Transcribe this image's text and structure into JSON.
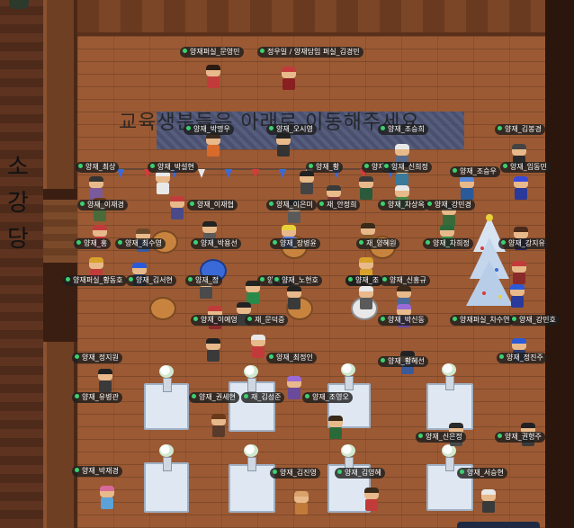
{
  "room": {
    "stage_label": "소강당",
    "notice": "교육생분들은 아래로 이동해주세요"
  },
  "colors": {
    "floor": "#9b5a34",
    "wall": "#5e3420",
    "banner": "#4a5e8a",
    "nametag_bg": "#1e1e1e",
    "online_dot": "#3bd16f"
  },
  "icons": {
    "online_status": "online-dot-icon",
    "christmas_tree": "christmas-tree-icon",
    "flower_vase": "flower-vase-icon"
  },
  "avatars": [
    {
      "name": "양재퍼실_문영민",
      "hair": "#2b1a10",
      "shirt": "#c23b3b"
    },
    {
      "name": "정우일 / 양재담임 퍼실_김경민",
      "hair": "#c23b3b",
      "shirt": "#8a1f1f"
    },
    {
      "name": "양재_박명우",
      "hair": "#3a2a20",
      "shirt": "#d86a2b"
    },
    {
      "name": "양재_오시영",
      "hair": "#222222",
      "shirt": "#333333"
    },
    {
      "name": "양재_조승희",
      "hair": "#e8e8e8",
      "shirt": "#5a6a8a"
    },
    {
      "name": "양재_김봉경",
      "hair": "#444444",
      "shirt": "#2a2a2a"
    },
    {
      "name": "양재_최상",
      "hair": "#333333",
      "shirt": "#7a5a9a"
    },
    {
      "name": "양재_박설현",
      "hair": "#e8e8e8",
      "shirt": "#e8e8e8"
    },
    {
      "name": "양재_황",
      "hair": "#222222",
      "shirt": "#444444"
    },
    {
      "name": "양재_차",
      "hair": "#3a3a3a",
      "shirt": "#2a5a3a"
    },
    {
      "name": "양재_신희정",
      "hair": "#222222",
      "shirt": "#3a7a9a"
    },
    {
      "name": "양재_조승우",
      "hair": "#5a8ad8",
      "shirt": "#2a5a9a"
    },
    {
      "name": "양재_임동민",
      "hair": "#3a4ad8",
      "shirt": "#2a3a9a"
    },
    {
      "name": "양재_이재경",
      "hair": "#6a3a1a",
      "shirt": "#4a6a3a"
    },
    {
      "name": "양재_이재협",
      "hair": "#c23b3b",
      "shirt": "#4a4a8a"
    },
    {
      "name": "양재_이은미",
      "hair": "#222222",
      "shirt": "#5a5a5a"
    },
    {
      "name": "재_안정희",
      "hair": "#3a3a3a",
      "shirt": "#7a3a3a"
    },
    {
      "name": "양재_차상옥",
      "hair": "#e8e8e8",
      "shirt": "#4a8a4a"
    },
    {
      "name": "양재_강민경",
      "hair": "#222222",
      "shirt": "#3a6a3a"
    },
    {
      "name": "양재_강지유",
      "hair": "#4a2a1a",
      "shirt": "#2a2a6a"
    },
    {
      "name": "양재_홍",
      "hair": "#c23b3b",
      "shirt": "#c23b3b"
    },
    {
      "name": "양재_최수영",
      "hair": "#6a4a2a",
      "shirt": "#3a5a9a"
    },
    {
      "name": "양재_박용선",
      "hair": "#222222",
      "shirt": "#5a5a5a"
    },
    {
      "name": "양재_장병윤",
      "hair": "#e8d23b",
      "shirt": "#5a7ad8"
    },
    {
      "name": "재_양혜원",
      "hair": "#3a2a1a",
      "shirt": "#8a5a2a"
    },
    {
      "name": "양재_차희정",
      "hair": "#2a6a3a",
      "shirt": "#3a8a4a"
    },
    {
      "name": "양재퍼실_황동호",
      "hair": "#d8a22b",
      "shirt": "#c23b3b"
    },
    {
      "name": "양재_김서현",
      "hair": "#2a5ad8",
      "shirt": "#2a3a6a"
    },
    {
      "name": "양재_정",
      "hair": "#3a2a1a",
      "shirt": "#4a4a4a"
    },
    {
      "name": "양재_김",
      "hair": "#222222",
      "shirt": "#2a8a4a"
    },
    {
      "name": "양재_노현호",
      "hair": "#222222",
      "shirt": "#3a3a3a"
    },
    {
      "name": "양재_양",
      "hair": "#d8a22b",
      "shirt": "#d8a22b"
    },
    {
      "name": "양재_조",
      "hair": "#e8e8e8",
      "shirt": "#5a5a5a"
    },
    {
      "name": "양재_신홍규",
      "hair": "#3a2a1a",
      "shirt": "#4a6a9a"
    },
    {
      "name": "양재_이예영",
      "hair": "#c23b3b",
      "shirt": "#8a2a2a"
    },
    {
      "name": "재_문덕증",
      "hair": "#222222",
      "shirt": "#3a3a3a"
    },
    {
      "name": "양재_박신동",
      "hair": "#9a6ad8",
      "shirt": "#6a4a9a"
    },
    {
      "name": "양재퍼실_차수연",
      "hair": "#c23b3b",
      "shirt": "#8a2a2a"
    },
    {
      "name": "양재_강민호",
      "hair": "#2a5ad8",
      "shirt": "#2a3a9a"
    },
    {
      "name": "양재_정지원",
      "hair": "#222222",
      "shirt": "#3a3a3a"
    },
    {
      "name": "양재_최정인",
      "hair": "#e8e8e8",
      "shirt": "#c23b3b"
    },
    {
      "name": "양재_황혜선",
      "hair": "#222222",
      "shirt": "#3a5a9a"
    },
    {
      "name": "양재_정진주",
      "hair": "#2a5ad8",
      "shirt": "#2a3a6a"
    },
    {
      "name": "양재_유병관",
      "hair": "#222222",
      "shirt": "#3a3a3a"
    },
    {
      "name": "양재_권세현",
      "hair": "#6a3a1a",
      "shirt": "#5a3a2a"
    },
    {
      "name": "재_김성준",
      "hair": "#9a6ad8",
      "shirt": "#6a4a9a"
    },
    {
      "name": "양재_조영오",
      "hair": "#3a2a1a",
      "shirt": "#2a6a3a"
    },
    {
      "name": "양재_신은정",
      "hair": "#2a2a2a",
      "shirt": "#4a4a4a"
    },
    {
      "name": "양재_권형주",
      "hair": "#222222",
      "shirt": "#3a3a3a"
    },
    {
      "name": "양재_박재경",
      "hair": "#d86a9a",
      "shirt": "#5aa2d8"
    },
    {
      "name": "양재_김진영",
      "hair": "#d8a26a",
      "shirt": "#c27a3b"
    },
    {
      "name": "양재_김영혜",
      "hair": "#3a2a1a",
      "shirt": "#c23b3b"
    },
    {
      "name": "양재_서승현",
      "hair": "#e8e8e8",
      "shirt": "#3a3a3a"
    }
  ]
}
